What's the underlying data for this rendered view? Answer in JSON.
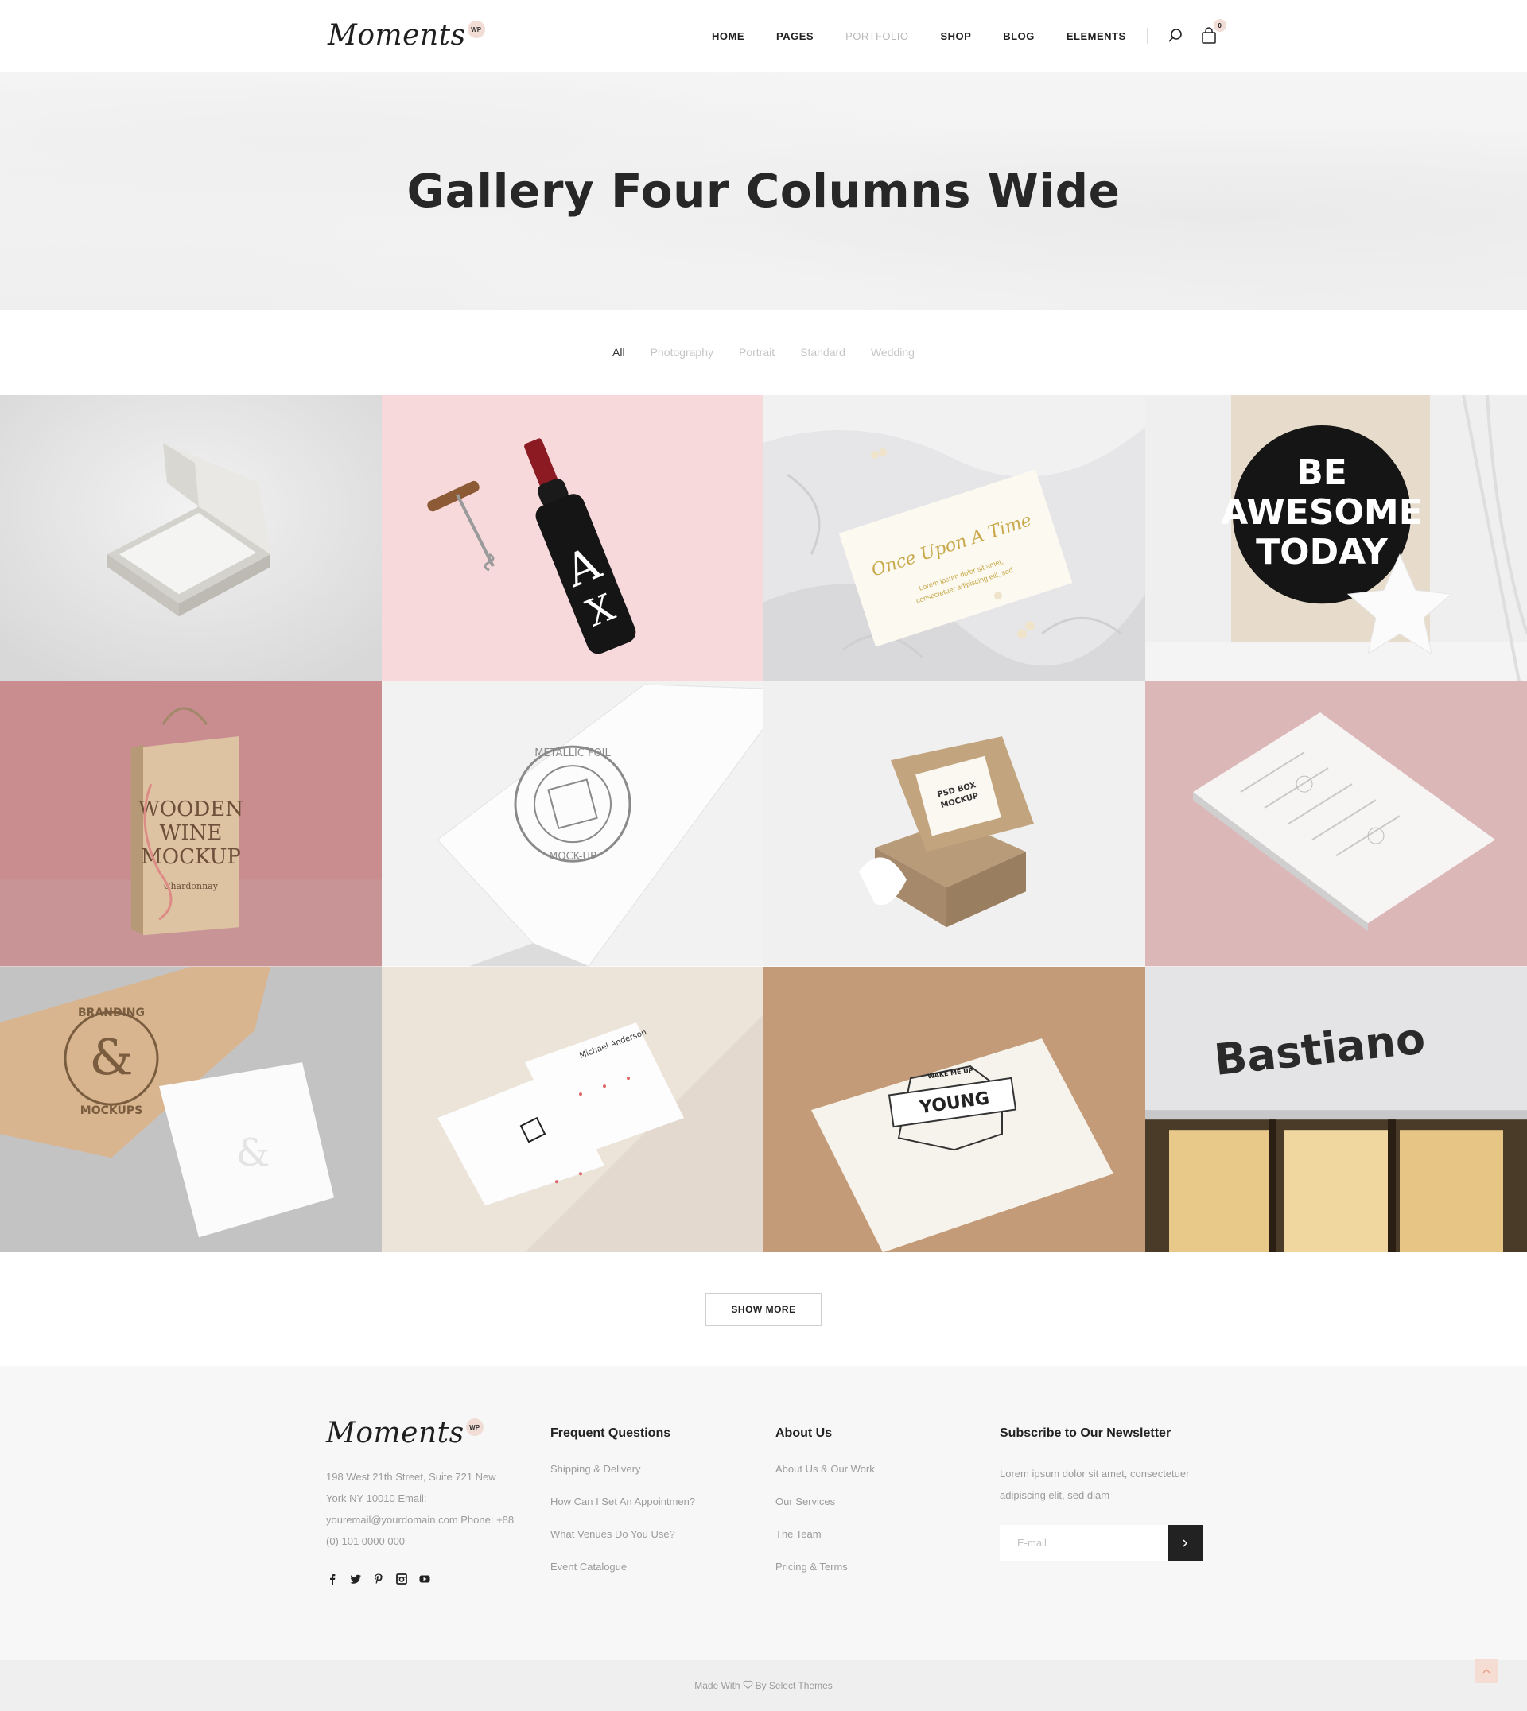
{
  "brand": {
    "logo_text": "Moments",
    "badge": "WP"
  },
  "nav": {
    "items": [
      {
        "label": "HOME"
      },
      {
        "label": "PAGES"
      },
      {
        "label": "PORTFOLIO"
      },
      {
        "label": "SHOP"
      },
      {
        "label": "BLOG"
      },
      {
        "label": "ELEMENTS"
      }
    ],
    "cart_count": "0"
  },
  "hero": {
    "title": "Gallery Four Columns Wide"
  },
  "filters": [
    "All",
    "Photography",
    "Portrait",
    "Standard",
    "Wedding"
  ],
  "gallery": {
    "tiles": [
      {
        "icon": "business-card-box-image"
      },
      {
        "icon": "wine-bottle-image"
      },
      {
        "icon": "wedding-card-image",
        "text_1": "Once Upon A Time",
        "text_2": "Lorem ipsum dolor sit amet,",
        "text_3": "consectetuer adipiscing elit, sed"
      },
      {
        "icon": "poster-image",
        "text_1": "BE",
        "text_2": "AWESOME",
        "text_3": "TODAY"
      },
      {
        "icon": "wooden-wine-box-image",
        "text_1": "WOODEN",
        "text_2": "WINE",
        "text_3": "MOCKUP",
        "text_4": "Chardonnay"
      },
      {
        "icon": "metallic-foil-image",
        "text_1": "METALLIC FOIL",
        "text_2": "MOCK-UP"
      },
      {
        "icon": "kraft-box-image",
        "text_1": "PSD BOX",
        "text_2": "MOCKUP"
      },
      {
        "icon": "letterhead-image"
      },
      {
        "icon": "branding-mockups-image",
        "text_1": "BRANDING",
        "text_2": "MOCKUPS"
      },
      {
        "icon": "business-cards-image",
        "text_1": "Michael Anderson"
      },
      {
        "icon": "young-card-image",
        "text_1": "YOUNG",
        "text_2": "WAKE ME UP"
      },
      {
        "icon": "storefront-image",
        "text_1": "Bastiano"
      }
    ]
  },
  "show_more": "SHOW MORE",
  "footer": {
    "address": "198 West 21th Street, Suite 721 New York NY 10010 Email: youremail@yourdomain.com Phone: +88 (0) 101 0000 000",
    "col2": {
      "heading": "Frequent Questions",
      "links": [
        "Shipping & Delivery",
        "How Can I Set An Appointmen?",
        "What Venues Do You Use?",
        "Event Catalogue"
      ]
    },
    "col3": {
      "heading": "About Us",
      "links": [
        "About Us & Our Work",
        "Our Services",
        "The Team",
        "Pricing & Terms"
      ]
    },
    "col4": {
      "heading": "Subscribe to Our Newsletter",
      "text": "Lorem ipsum dolor sit amet, consectetuer adipiscing elit, sed diam",
      "placeholder": "E-mail"
    },
    "socials": [
      "facebook-icon",
      "twitter-icon",
      "pinterest-icon",
      "instagram-icon",
      "youtube-icon"
    ]
  },
  "bottom": {
    "made_with": "Made With",
    "by": "By Select Themes"
  },
  "colors": {
    "accent": "#f1ddd5",
    "dark": "#222222",
    "muted": "#9b9b9b"
  }
}
